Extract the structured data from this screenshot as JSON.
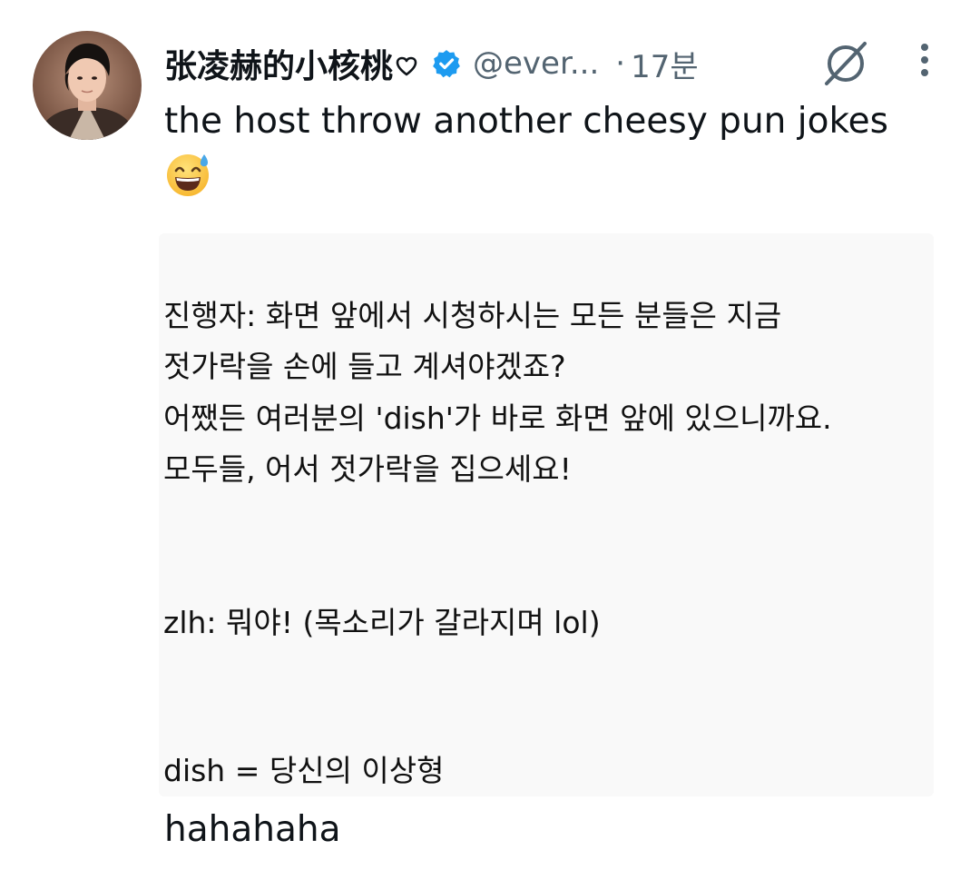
{
  "tweet": {
    "display_name": "张凌赫的小核桃",
    "name_suffix_icon": "heart-outline-icon",
    "verified_icon": "verified-badge-icon",
    "handle": "@ever...",
    "separator": "·",
    "time": "17분",
    "text_line": "the host throw another cheesy pun jokes",
    "emoji": "grinning-face-with-sweat-emoji",
    "footer_text": "hahahaha"
  },
  "image_text": {
    "line1": "진행자: 화면 앞에서 시청하시는 모든 분들은 지금",
    "line2": "젓가락을 손에 들고 계셔야겠죠?",
    "line3": "어쨌든 여러분의 'dish'가 바로 화면 앞에 있으니까요.",
    "line4": "모두들, 어서 젓가락을 집으세요!",
    "line5": "zlh: 뭐야! (목소리가 갈라지며 lol)",
    "line6": "dish = 당신의 이상형"
  },
  "colors": {
    "verified_blue": "#1d9bf0",
    "secondary_text": "#536471",
    "primary_text": "#0f1419",
    "image_background": "#f9f9f9"
  }
}
